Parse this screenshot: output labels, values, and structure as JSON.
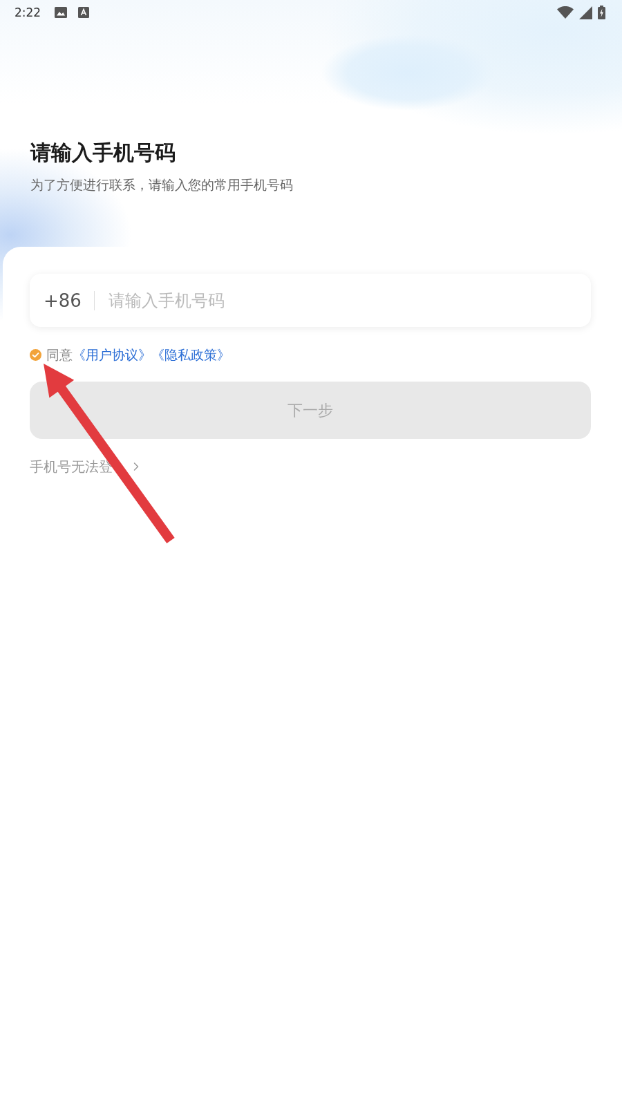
{
  "status_bar": {
    "time": "2:22"
  },
  "header": {
    "title": "请输入手机号码",
    "subtitle": "为了方便进行联系，请输入您的常用手机号码"
  },
  "phone_field": {
    "country_code": "+86",
    "placeholder": "请输入手机号码"
  },
  "agreement": {
    "checked": true,
    "label": "同意",
    "links": [
      "《用户协议》",
      "《隐私政策》"
    ]
  },
  "next_button": {
    "label": "下一步",
    "disabled": true
  },
  "help_link": {
    "label": "手机号无法登"
  },
  "annotation": {
    "kind": "arrow"
  }
}
